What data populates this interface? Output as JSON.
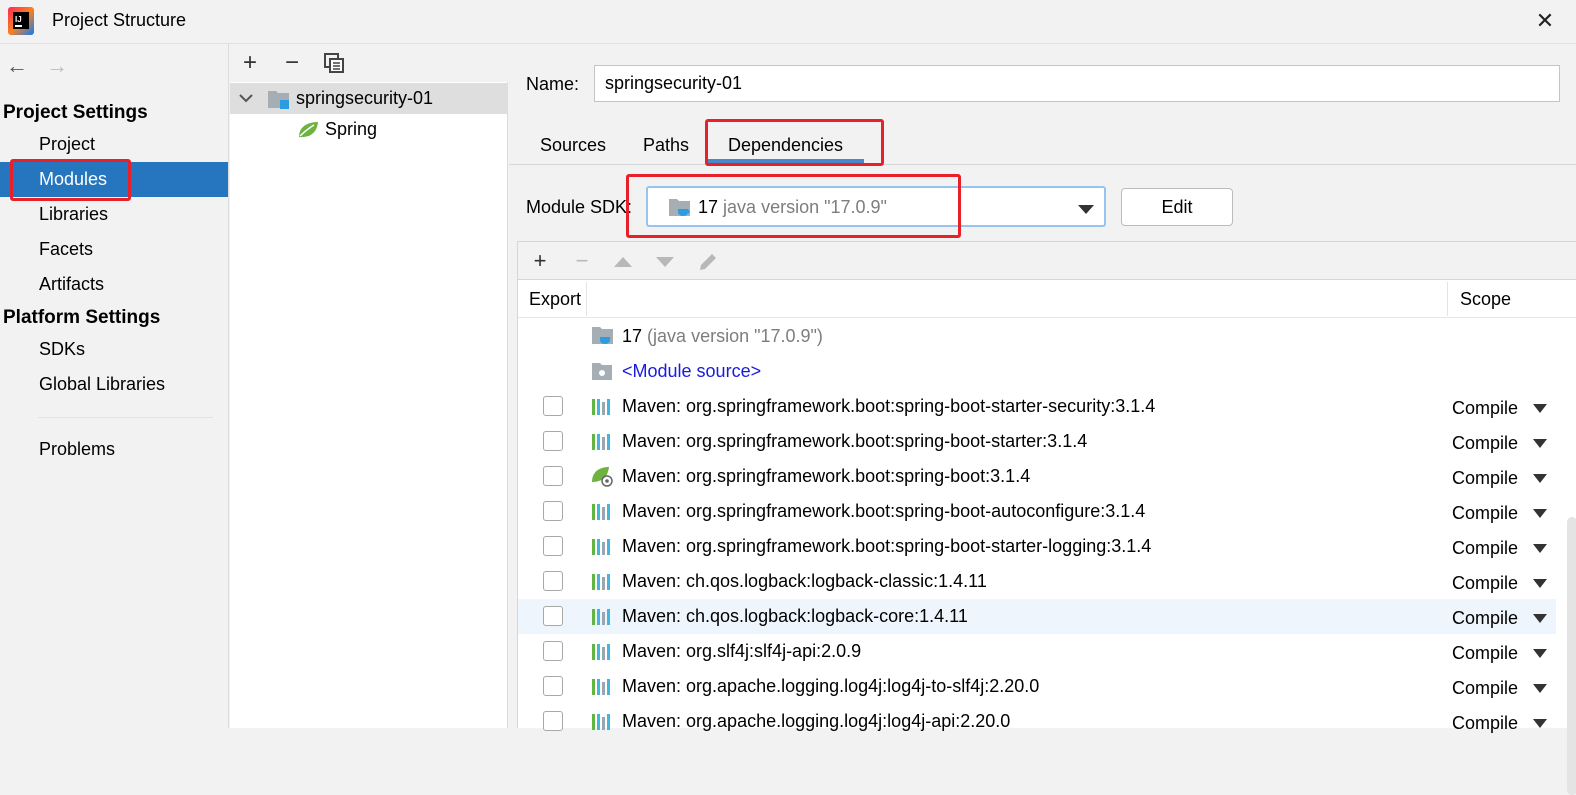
{
  "window": {
    "title": "Project Structure",
    "close_glyph": "✕"
  },
  "nav": {
    "back_glyph": "←",
    "forward_glyph": "→"
  },
  "sidebar": {
    "project_settings_header": "Project Settings",
    "project_items": [
      {
        "label": "Project"
      },
      {
        "label": "Modules",
        "selected": true
      },
      {
        "label": "Libraries"
      },
      {
        "label": "Facets"
      },
      {
        "label": "Artifacts"
      }
    ],
    "platform_settings_header": "Platform Settings",
    "platform_items": [
      {
        "label": "SDKs"
      },
      {
        "label": "Global Libraries"
      }
    ],
    "problems_label": "Problems"
  },
  "module_tree": {
    "toolbar": {
      "add": "+",
      "remove": "−",
      "copy_icon": "copy-icon"
    },
    "root": {
      "label": "springsecurity-01",
      "expanded": true,
      "icon": "module-folder-icon"
    },
    "children": [
      {
        "label": "Spring",
        "icon": "spring-leaf-icon"
      }
    ]
  },
  "module": {
    "name_label": "Name:",
    "name_value": "springsecurity-01",
    "tabs": [
      {
        "label": "Sources"
      },
      {
        "label": "Paths"
      },
      {
        "label": "Dependencies",
        "active": true
      }
    ],
    "sdk_label": "Module SDK:",
    "sdk_value": "17",
    "sdk_version": "java version \"17.0.9\"",
    "edit_button": "Edit"
  },
  "dependencies": {
    "toolbar": {
      "add": "+",
      "remove": "−"
    },
    "columns": {
      "export": "Export",
      "scope": "Scope"
    },
    "sdk_row": {
      "name": "17",
      "detail": "(java version \"17.0.9\")"
    },
    "module_source_row": {
      "label": "<Module source>"
    },
    "rows": [
      {
        "name": "Maven: org.springframework.boot:spring-boot-starter-security:3.1.4",
        "scope": "Compile",
        "icon": "maven-library-icon"
      },
      {
        "name": "Maven: org.springframework.boot:spring-boot-starter:3.1.4",
        "scope": "Compile",
        "icon": "maven-library-icon"
      },
      {
        "name": "Maven: org.springframework.boot:spring-boot:3.1.4",
        "scope": "Compile",
        "icon": "spring-boot-icon"
      },
      {
        "name": "Maven: org.springframework.boot:spring-boot-autoconfigure:3.1.4",
        "scope": "Compile",
        "icon": "maven-library-icon"
      },
      {
        "name": "Maven: org.springframework.boot:spring-boot-starter-logging:3.1.4",
        "scope": "Compile",
        "icon": "maven-library-icon"
      },
      {
        "name": "Maven: ch.qos.logback:logback-classic:1.4.11",
        "scope": "Compile",
        "icon": "maven-library-icon"
      },
      {
        "name": "Maven: ch.qos.logback:logback-core:1.4.11",
        "scope": "Compile",
        "icon": "maven-library-icon",
        "highlighted": true
      },
      {
        "name": "Maven: org.slf4j:slf4j-api:2.0.9",
        "scope": "Compile",
        "icon": "maven-library-icon"
      },
      {
        "name": "Maven: org.apache.logging.log4j:log4j-to-slf4j:2.20.0",
        "scope": "Compile",
        "icon": "maven-library-icon"
      },
      {
        "name": "Maven: org.apache.logging.log4j:log4j-api:2.20.0",
        "scope": "Compile",
        "icon": "maven-library-icon"
      }
    ]
  },
  "colors": {
    "selection": "#2675bf",
    "highlight_box": "#e8202a",
    "link": "#1a1adf",
    "tab_underline": "#4a88c7"
  }
}
